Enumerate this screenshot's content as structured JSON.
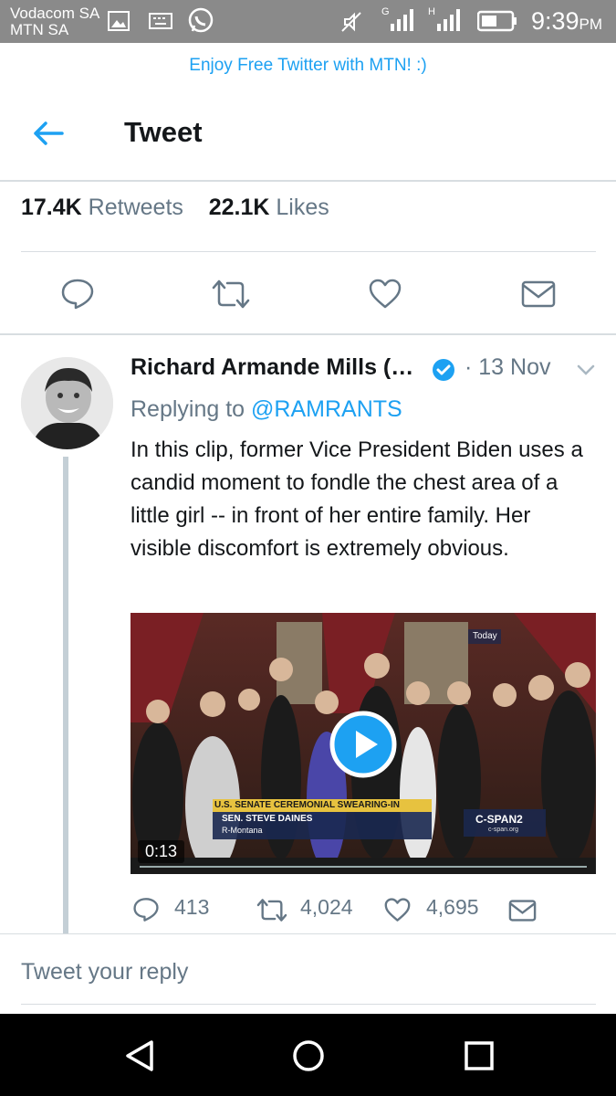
{
  "status_bar": {
    "carrier_line1": "Vodacom SA",
    "carrier_line2": "MTN SA",
    "time": "9:39",
    "ampm": "PM",
    "icons": [
      "gallery-icon",
      "keyboard-icon",
      "whatsapp-icon",
      "mute-icon",
      "signal-g-icon",
      "signal-h-icon",
      "battery-icon"
    ]
  },
  "promo": {
    "text": "Enjoy Free Twitter with MTN! :)"
  },
  "header": {
    "title": "Tweet",
    "back_icon": "back-arrow-icon"
  },
  "stats": {
    "retweets_count": "17.4K",
    "retweets_label": "Retweets",
    "likes_count": "22.1K",
    "likes_label": "Likes"
  },
  "actions": [
    "reply-icon",
    "retweet-icon",
    "like-icon",
    "message-icon"
  ],
  "reply_tweet": {
    "author": "Richard Armande Mills (…",
    "date": "· 13 Nov",
    "replying_label": "Replying to",
    "replying_handle": "@RAMRANTS",
    "text": "In this clip, former Vice President Biden uses a candid moment to fondle the chest area of a little girl -- in front of her entire family. Her visible discomfort is extremely obvious.",
    "video": {
      "banner": "U.S. SENATE CEREMONIAL SWEARING-IN",
      "name": "SEN. STEVE DAINES",
      "state": "R-Montana",
      "network": "C-SPAN2",
      "network_url": "c-span.org",
      "today": "Today",
      "duration": "0:13"
    },
    "replies": "413",
    "retweets": "4,024",
    "likes": "4,695"
  },
  "reply_input": {
    "placeholder": "Tweet your reply"
  },
  "colors": {
    "accent": "#1da1f2",
    "muted": "#657786",
    "text": "#14171a",
    "statusbar": "#8a8a8a"
  }
}
